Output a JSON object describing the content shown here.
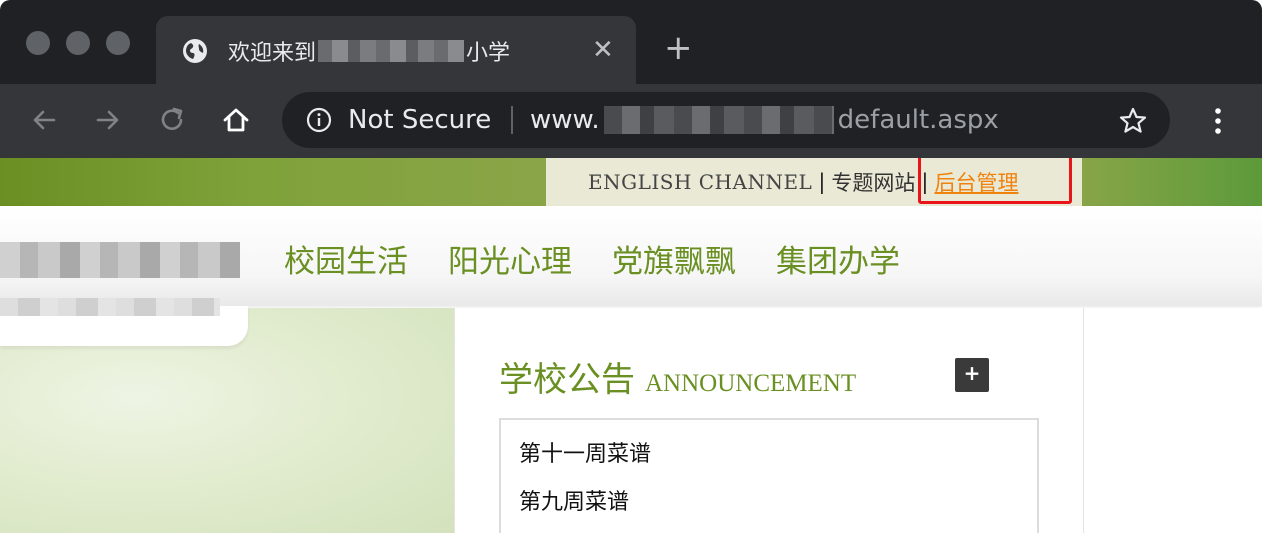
{
  "browser": {
    "tab": {
      "title_prefix": "欢迎来到",
      "title_suffix": "小学",
      "close_glyph": "✕"
    },
    "new_tab_glyph": "+",
    "address": {
      "security_label": "Not Secure",
      "url_prefix": "www.",
      "url_suffix": "default.aspx"
    },
    "icons": [
      "globe-icon",
      "back-icon",
      "forward-icon",
      "reload-icon",
      "home-icon",
      "info-icon",
      "star-icon",
      "menu-icon"
    ]
  },
  "page": {
    "top_links": {
      "english": "ENGLISH CHANNEL",
      "separator": "|",
      "topic": "专题网站",
      "admin": "后台管理"
    },
    "nav": [
      "校园生活",
      "阳光心理",
      "党旗飘飘",
      "集团办学"
    ],
    "announcement": {
      "title_cn": "学校公告",
      "title_en": "ANNOUNCEMENT",
      "more_glyph": "+",
      "items": [
        "第十一周菜谱",
        "第九周菜谱"
      ]
    }
  },
  "colors": {
    "accent_green": "#6a8f22",
    "admin_link": "#f0820e",
    "highlight": "#e8141a"
  }
}
